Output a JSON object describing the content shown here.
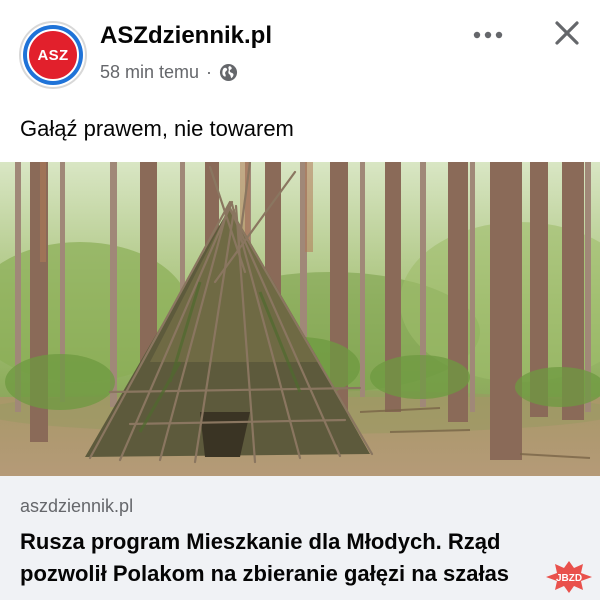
{
  "post": {
    "page_name": "ASZdziennik.pl",
    "avatar_text": "ASZ",
    "timestamp": "58 min temu",
    "separator": "·",
    "audience_icon": "globe-icon",
    "more_icon": "more-options-icon",
    "close_icon": "close-icon",
    "caption": "Gałąź prawem, nie towarem"
  },
  "photo": {
    "subject": "forest-branch-shelter",
    "colors": {
      "foliage": "#7a9a4a",
      "trunk": "#8a6a58",
      "ground": "#b59a78"
    }
  },
  "link_preview": {
    "domain": "aszdziennik.pl",
    "title_line1": "Rusza program Mieszkanie dla Młodych. Rząd",
    "title_line2": "pozwolił Polakom na zbieranie gałęzi na szałas"
  },
  "watermark": {
    "text": "JBZD"
  },
  "colors": {
    "brand_red": "#e2202c",
    "brand_blue": "#1f73d8",
    "text_primary": "#050505",
    "text_secondary": "#65676b",
    "card_bg": "#f0f2f5"
  }
}
